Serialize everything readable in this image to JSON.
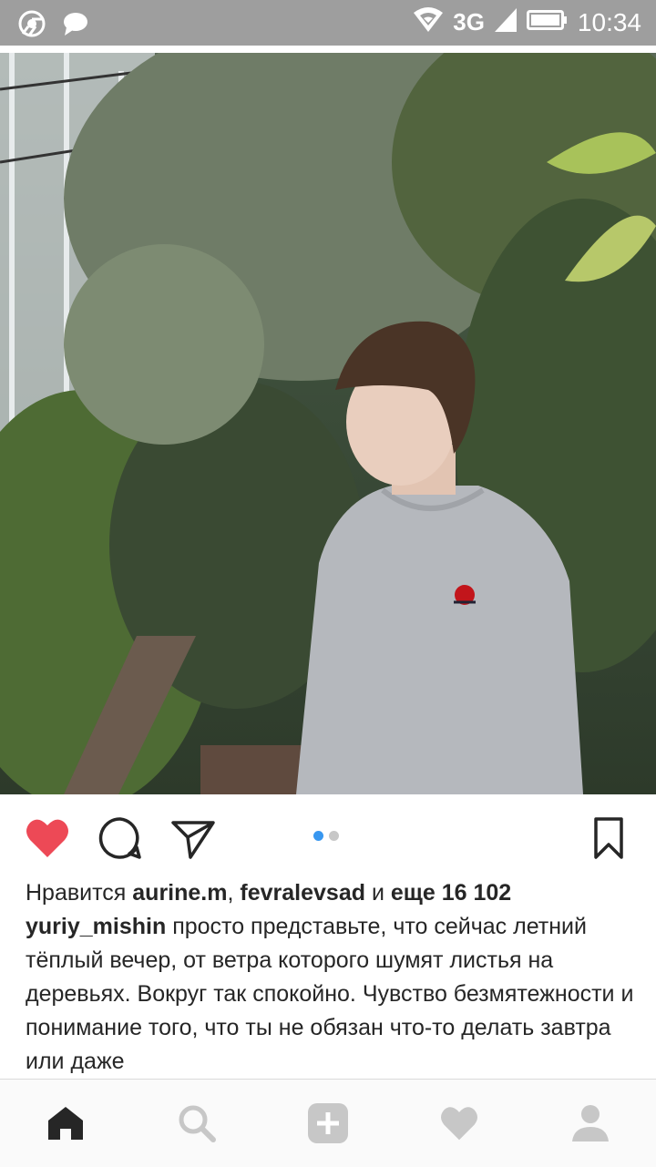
{
  "status_bar": {
    "time": "10:34",
    "network": "3G",
    "icons": [
      "chrome-icon",
      "chat-bubble-icon",
      "wifi-icon",
      "signal-icon",
      "battery-icon"
    ]
  },
  "post": {
    "image_alt": "",
    "carousel": {
      "count": 2,
      "active": 0
    },
    "likes": {
      "prefix": "Нравится",
      "user1": "aurine.m",
      "sep": ",",
      "user2": "fevralevsad",
      "and": "и",
      "more": "еще 16 102"
    },
    "caption": {
      "username": "yuriy_mishin",
      "text": "просто представьте, что сейчас летний тёплый вечер, от ветра которого шумят листья на деревьях. Вокруг так спокойно. Чувство безмятежности и понимание того, что ты не обязан что-то делать завтра или даже"
    }
  },
  "nav": [
    "home-icon",
    "search-icon",
    "add-icon",
    "heart-icon",
    "profile-icon"
  ],
  "colors": {
    "like": "#ed4956",
    "active_dot": "#3897f0",
    "statusbar": "#9e9e9e",
    "text": "#262626"
  }
}
